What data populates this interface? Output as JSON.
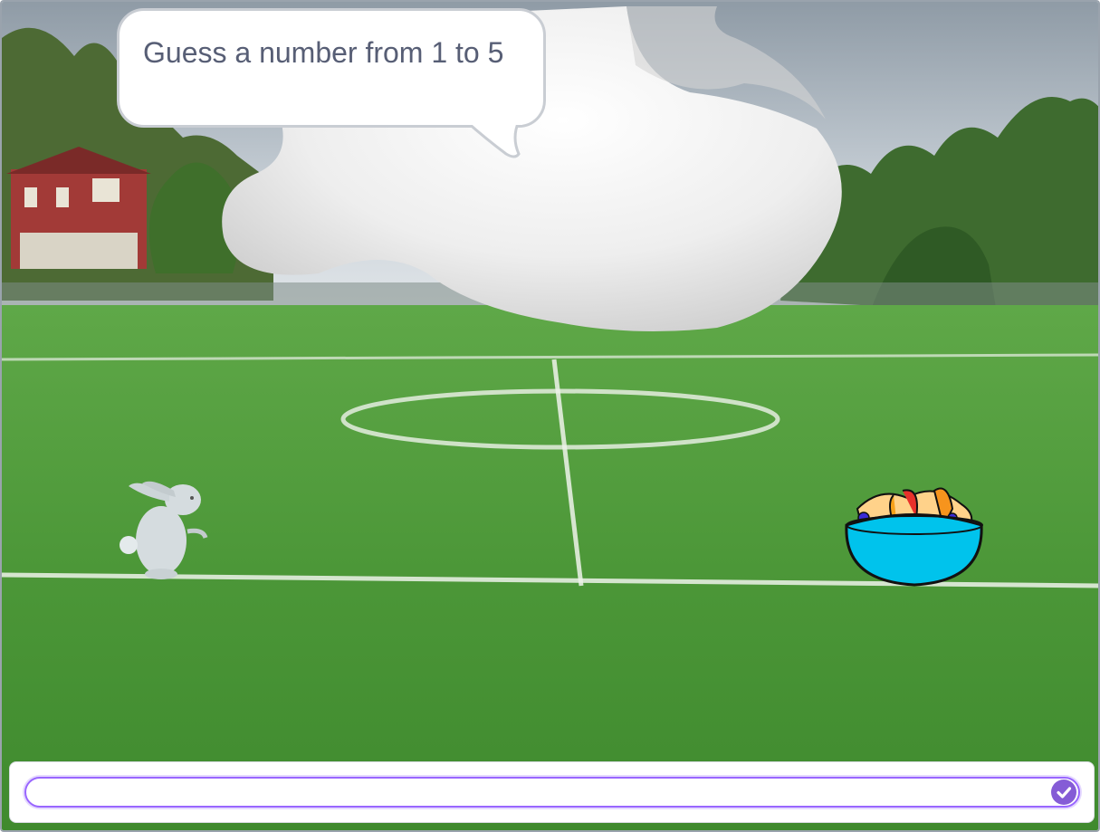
{
  "stage": {
    "backdrop": "soccer-field",
    "colors": {
      "sky": "#aebbc6",
      "grass": "#4e9a3a",
      "bowl": "#00c3ec",
      "accent": "#855cd6"
    }
  },
  "sprites": [
    {
      "name": "rabbit-sprite",
      "icon": "rabbit"
    },
    {
      "name": "fruit-bowl-sprite",
      "icon": "fruit-bowl"
    },
    {
      "name": "ghost-sprite",
      "icon": "ghost-cloud"
    }
  ],
  "speech": {
    "text": "Guess a number from 1 to 5"
  },
  "ask": {
    "answer_value": "",
    "submit_icon": "check-icon"
  }
}
